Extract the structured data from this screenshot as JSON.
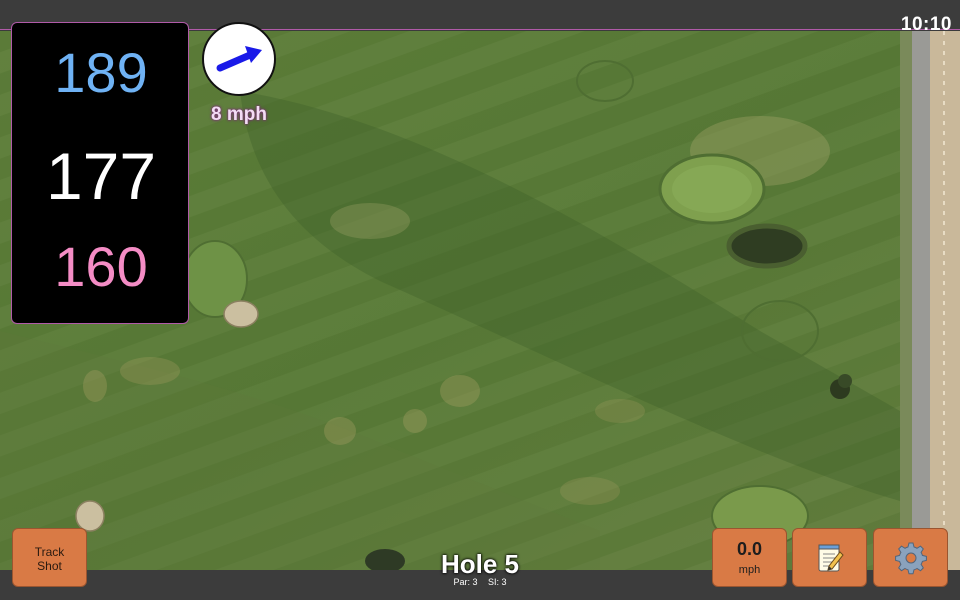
{
  "status_bar": {
    "clock": "10:10"
  },
  "distances": {
    "back": "189",
    "center": "177",
    "front": "160"
  },
  "wind": {
    "speed_label": "8 mph",
    "arrow_icon": "wind-direction-arrow-icon",
    "arrow_color": "#1a1ae8"
  },
  "hole": {
    "title": "Hole 5",
    "par": "Par: 3",
    "si": "SI: 3"
  },
  "buttons": {
    "track_shot_line1": "Track",
    "track_shot_line2": "Shot",
    "wind_value": "0.0",
    "wind_unit": "mph",
    "notes_icon": "notepad-icon",
    "settings_icon": "gear-icon"
  },
  "colors": {
    "back_distance": "#6fb2f4",
    "center_distance": "#ffffff",
    "front_distance": "#f48cc5",
    "button_fill": "#d97a45"
  }
}
